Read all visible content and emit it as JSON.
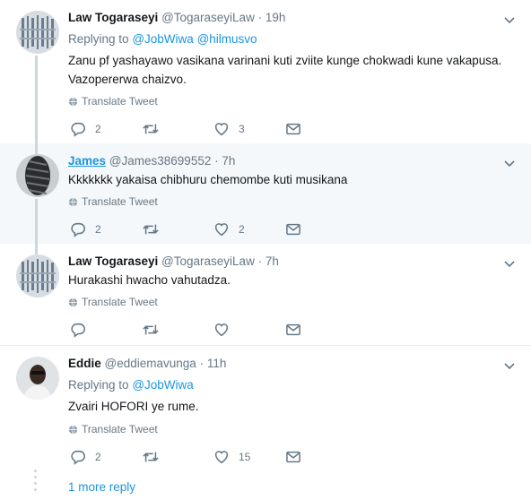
{
  "tweets": [
    {
      "name": "Law Togaraseyi",
      "handle": "@TogaraseyiLaw",
      "dot": "·",
      "time": "19h",
      "replying_prefix": "Replying to",
      "mentions": [
        "@JobWiwa",
        "@hilmusvo"
      ],
      "text_lines": [
        "Zanu pf yashayawo vasikana varinani kuti zviite kunge chokwadi kune vakapusa.",
        "Vazopererwa chaizvo."
      ],
      "translate": "Translate Tweet",
      "replies": "2",
      "retweets": "",
      "likes": "3"
    },
    {
      "name": "James",
      "handle": "@James38699552",
      "dot": "·",
      "time": "7h",
      "text_lines": [
        "Kkkkkkk yakaisa chibhuru chemombe kuti musikana"
      ],
      "translate": "Translate Tweet",
      "replies": "2",
      "retweets": "",
      "likes": "2"
    },
    {
      "name": "Law Togaraseyi",
      "handle": "@TogaraseyiLaw",
      "dot": "·",
      "time": "7h",
      "text_lines": [
        "Hurakashi hwacho vahutadza."
      ],
      "translate": "Translate Tweet",
      "replies": "",
      "retweets": "",
      "likes": ""
    },
    {
      "name": "Eddie",
      "handle": "@eddiemavunga",
      "dot": "·",
      "time": "11h",
      "replying_prefix": "Replying to",
      "mentions": [
        "@JobWiwa"
      ],
      "text_lines": [
        "Zvairi HOFORI ye rume."
      ],
      "translate": "Translate Tweet",
      "replies": "2",
      "retweets": "",
      "likes": "15"
    }
  ],
  "more_reply": "1 more reply",
  "colors": {
    "accent": "#1b95e0",
    "muted": "#657786",
    "line": "#ccd6dd",
    "highlight": "#f5f8fa"
  }
}
